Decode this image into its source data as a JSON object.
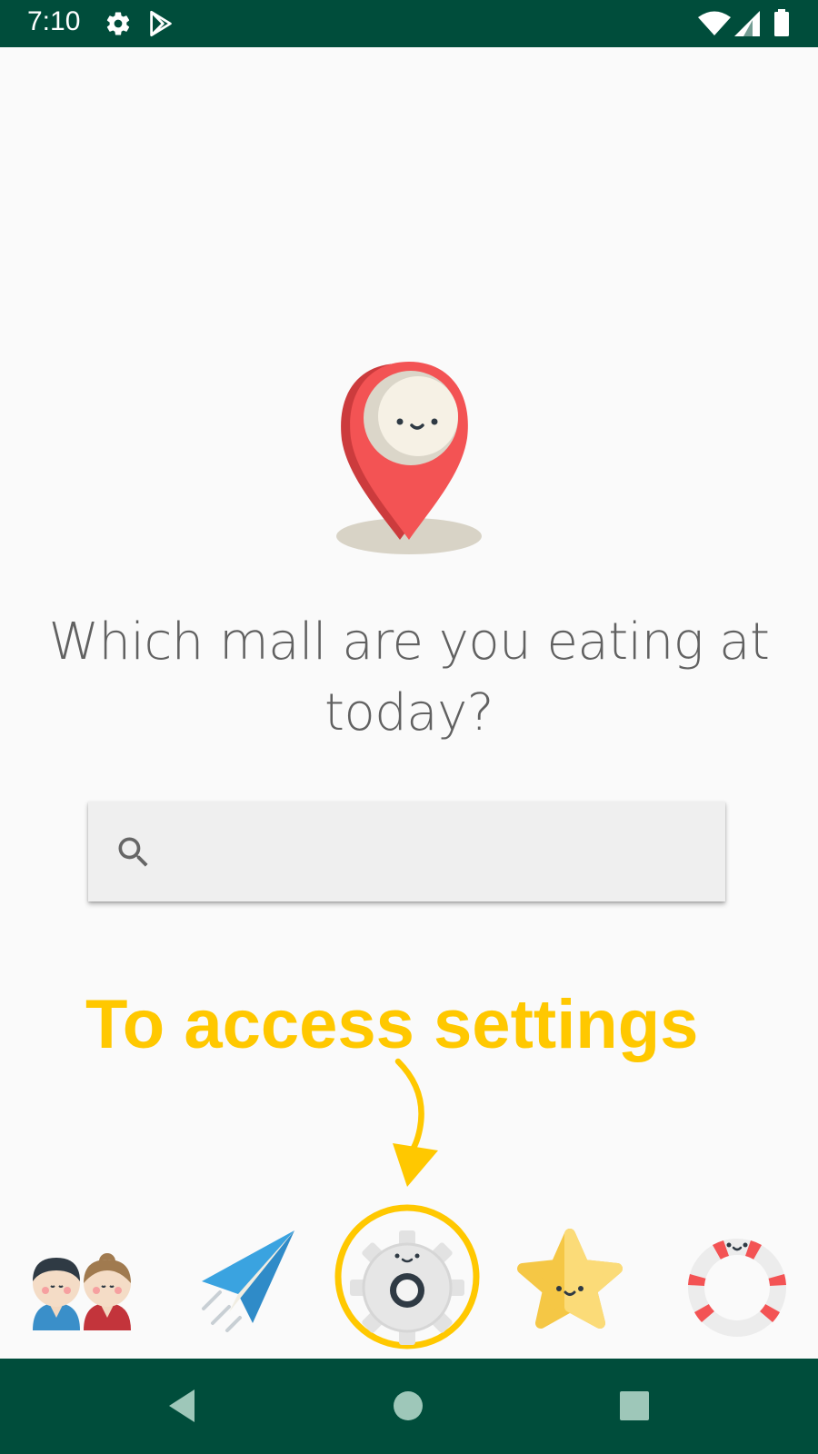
{
  "status_bar": {
    "time": "7:10",
    "icons": [
      "settings-gear-icon",
      "play-store-icon",
      "wifi-icon",
      "signal-icon",
      "battery-icon"
    ]
  },
  "main": {
    "hero_icon": "location-pin-icon",
    "question": "Which mall are you eating at today?",
    "search": {
      "placeholder": "",
      "value": "",
      "icon": "search-icon"
    },
    "annotation": "To access settings"
  },
  "bottom_nav": {
    "items": [
      "friends-icon",
      "send-paper-plane-icon",
      "settings-gear-icon",
      "favorites-star-icon",
      "help-lifebuoy-icon"
    ],
    "highlighted": "settings-gear-icon"
  },
  "system_nav": [
    "back-button",
    "home-button",
    "recents-button"
  ],
  "colors": {
    "status_bar": "#004d3b",
    "nav_bar": "#004d3b",
    "background": "#fafafa",
    "annotation": "#ffc800",
    "pin": "#f35354"
  }
}
